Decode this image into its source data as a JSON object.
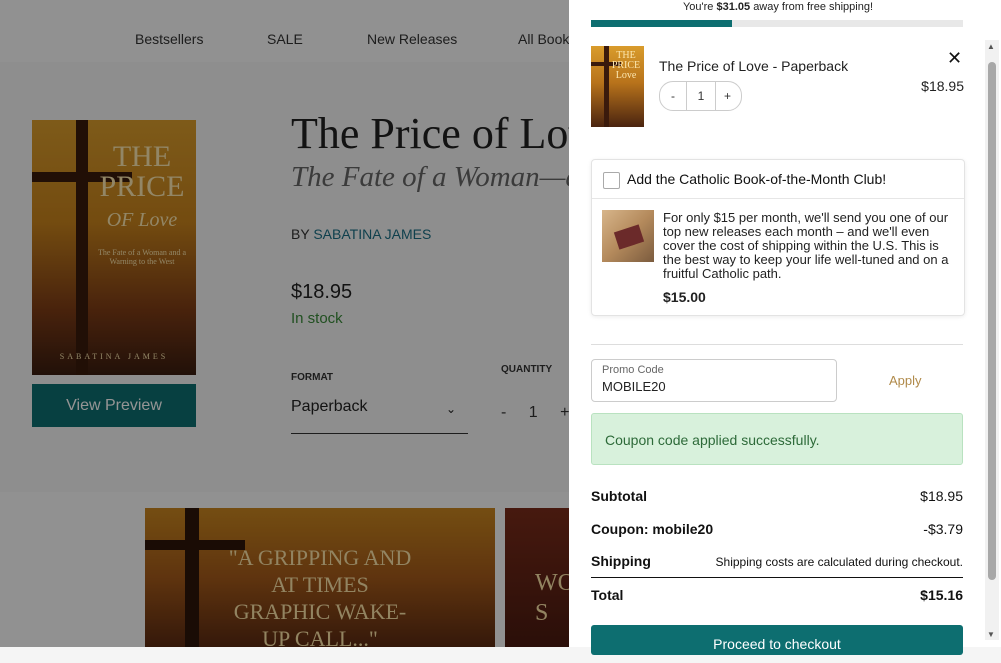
{
  "nav": {
    "items": [
      "Bestsellers",
      "SALE",
      "New Releases",
      "All Book"
    ]
  },
  "product": {
    "cover_title_line1": "THE",
    "cover_title_line2": "PRICE",
    "cover_title_line3": "OF Love",
    "cover_subtitle": "The Fate of a Woman and a Warning to the West",
    "cover_author": "SABATINA JAMES",
    "preview_label": "View Preview",
    "title": "The Price of Lov",
    "subtitle": "The Fate of a Woman—and a",
    "by_prefix": "BY",
    "author": "SABATINA JAMES",
    "price": "$18.95",
    "stock": "In stock",
    "format_label": "FORMAT",
    "format_value": "Paperback",
    "quantity_label": "QUANTITY",
    "qty_minus": "-",
    "qty_value": "1",
    "qty_plus": "+"
  },
  "banner": {
    "quote": "\"A GRIPPING AND AT TIMES GRAPHIC WAKE-UP CALL...\"",
    "second_text": "WO S"
  },
  "cart": {
    "shipping_msg_prefix": "You're",
    "shipping_msg_amount": "$31.05",
    "shipping_msg_suffix": "away from free shipping!",
    "shipping_progress": 0.38,
    "item": {
      "name": "The Price of Love - Paperback",
      "price": "$18.95",
      "qty": "1",
      "minus": "-",
      "plus": "+",
      "remove": "✕",
      "thumb_title": "THE PRICE Love"
    },
    "club": {
      "heading": "Add the Catholic Book-of-the-Month Club!",
      "description": "For only $15 per month, we'll send you one of our top new releases each month – and we'll even cover the cost of shipping within the U.S. This is the best way to keep your life well-tuned and on a fruitful Catholic path.",
      "price": "$15.00",
      "checked": false
    },
    "promo": {
      "label": "Promo Code",
      "value": "MOBILE20",
      "apply": "Apply"
    },
    "success_msg": "Coupon code applied successfully.",
    "summary": {
      "subtotal_label": "Subtotal",
      "subtotal_value": "$18.95",
      "coupon_label": "Coupon: mobile20",
      "coupon_value": "-$3.79",
      "shipping_label": "Shipping",
      "shipping_value": "Shipping costs are calculated during checkout.",
      "total_label": "Total",
      "total_value": "$15.16"
    },
    "checkout_label": "Proceed to checkout"
  },
  "colors": {
    "accent": "#0d6e70",
    "success_bg": "#d8f1dc",
    "apply": "#b08a4a"
  }
}
